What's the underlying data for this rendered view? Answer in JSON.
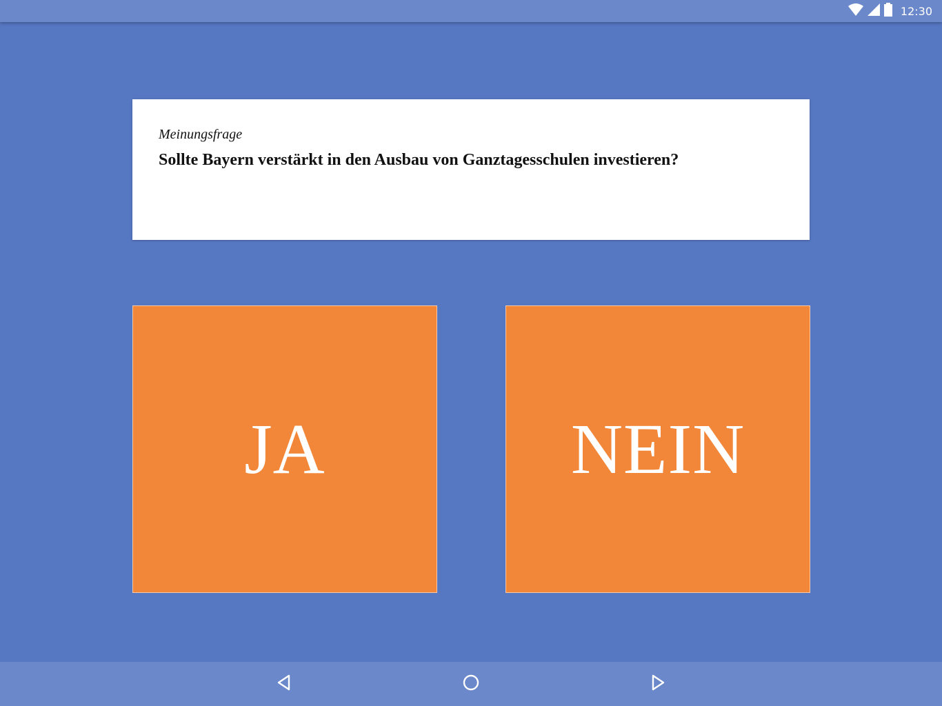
{
  "status_bar": {
    "time": "12:30",
    "icons": [
      "wifi-icon",
      "cell-signal-icon",
      "battery-icon"
    ]
  },
  "question": {
    "category": "Meinungsfrage",
    "text": "Sollte Bayern verstärkt in den Ausbau von Ganztagesschulen investieren?"
  },
  "answers": {
    "yes_label": "JA",
    "no_label": "NEIN"
  },
  "navigation": {
    "icons": [
      "back-icon",
      "home-icon",
      "forward-icon"
    ]
  },
  "colors": {
    "background": "#5677c2",
    "bars": "#6b88ca",
    "button": "#f2873a",
    "card": "#ffffff"
  }
}
